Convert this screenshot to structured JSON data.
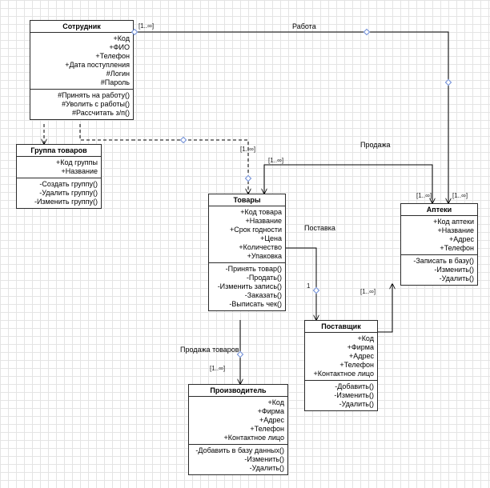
{
  "classes": {
    "employee": {
      "title": "Сотрудник",
      "attrs": [
        "+Код",
        "+ФИО",
        "+Телефон",
        "+Дата поступления",
        "#Логин",
        "#Пароль"
      ],
      "ops": [
        "#Принять на работу()",
        "#Уволить с работы()",
        "#Рассчитать з/п()"
      ]
    },
    "group": {
      "title": "Группа товаров",
      "attrs": [
        "+Код группы",
        "+Название"
      ],
      "ops": [
        "-Создать группу()",
        "-Удалить группу()",
        "-Изменить группу()"
      ]
    },
    "goods": {
      "title": "Товары",
      "attrs": [
        "+Код товара",
        "+Название",
        "+Срок годности",
        "+Цена",
        "+Количество",
        "+Упаковка"
      ],
      "ops": [
        "-Принять товар()",
        "-Продать()",
        "-Изменить запись()",
        "-Заказать()",
        "-Выписать чек()"
      ]
    },
    "pharmacy": {
      "title": "Аптеки",
      "attrs": [
        "+Код аптеки",
        "+Название",
        "+Адрес",
        "+Телефон"
      ],
      "ops": [
        "-Записать в базу()",
        "-Изменить()",
        "-Удалить()"
      ]
    },
    "supplier": {
      "title": "Поставщик",
      "attrs": [
        "+Код",
        "+Фирма",
        "+Адрес",
        "+Телефон",
        "+Контактное лицо"
      ],
      "ops": [
        "-Добавить()",
        "-Изменить()",
        "-Удалить()"
      ]
    },
    "manufacturer": {
      "title": "Производитель",
      "attrs": [
        "+Код",
        "+Фирма",
        "+Адрес",
        "+Телефон",
        "+Контактное лицо"
      ],
      "ops": [
        "-Добавить в базу данных()",
        "-Изменить()",
        "-Удалить()"
      ]
    }
  },
  "associations": {
    "work": "Работа",
    "sale": "Продажа",
    "delivery": "Поставка",
    "goods_sale": "Продажа товаров"
  },
  "mult": {
    "one_inf": "[1..∞]",
    "one": "1"
  },
  "chart_data": {
    "type": "uml-class-diagram",
    "classes": [
      {
        "id": "employee",
        "name": "Сотрудник",
        "attributes": [
          "+Код",
          "+ФИО",
          "+Телефон",
          "+Дата поступления",
          "#Логин",
          "#Пароль"
        ],
        "operations": [
          "#Принять на работу()",
          "#Уволить с работы()",
          "#Рассчитать з/п()"
        ]
      },
      {
        "id": "group",
        "name": "Группа товаров",
        "attributes": [
          "+Код группы",
          "+Название"
        ],
        "operations": [
          "-Создать группу()",
          "-Удалить группу()",
          "-Изменить группу()"
        ]
      },
      {
        "id": "goods",
        "name": "Товары",
        "attributes": [
          "+Код товара",
          "+Название",
          "+Срок годности",
          "+Цена",
          "+Количество",
          "+Упаковка"
        ],
        "operations": [
          "-Принять товар()",
          "-Продать()",
          "-Изменить запись()",
          "-Заказать()",
          "-Выписать чек()"
        ]
      },
      {
        "id": "pharmacy",
        "name": "Аптеки",
        "attributes": [
          "+Код аптеки",
          "+Название",
          "+Адрес",
          "+Телефон"
        ],
        "operations": [
          "-Записать в базу()",
          "-Изменить()",
          "-Удалить()"
        ]
      },
      {
        "id": "supplier",
        "name": "Поставщик",
        "attributes": [
          "+Код",
          "+Фирма",
          "+Адрес",
          "+Телефон",
          "+Контактное лицо"
        ],
        "operations": [
          "-Добавить()",
          "-Изменить()",
          "-Удалить()"
        ]
      },
      {
        "id": "manufacturer",
        "name": "Производитель",
        "attributes": [
          "+Код",
          "+Фирма",
          "+Адрес",
          "+Телефон",
          "+Контактное лицо"
        ],
        "operations": [
          "-Добавить в базу данных()",
          "-Изменить()",
          "-Удалить()"
        ]
      }
    ],
    "relations": [
      {
        "name": "Работа",
        "from": "employee",
        "to": "pharmacy",
        "from_mult": "[1..∞]",
        "to_mult": "[1..∞]",
        "style": "solid"
      },
      {
        "name": "",
        "from": "employee",
        "to": "group",
        "from_mult": "",
        "to_mult": "",
        "style": "dashed"
      },
      {
        "name": "",
        "from": "employee",
        "to": "goods",
        "from_mult": "",
        "to_mult": "[1..∞]",
        "style": "dashed"
      },
      {
        "name": "Продажа",
        "from": "goods",
        "to": "pharmacy",
        "from_mult": "[1..∞]",
        "to_mult": "[1..∞]",
        "style": "solid"
      },
      {
        "name": "Поставка",
        "from": "goods",
        "to": "supplier",
        "from_mult": "1",
        "to_mult": "[1..∞]",
        "style": "solid"
      },
      {
        "name": "Продажа товаров",
        "from": "goods",
        "to": "manufacturer",
        "from_mult": "",
        "to_mult": "[1..∞]",
        "style": "solid"
      },
      {
        "name": "",
        "from": "supplier",
        "to": "pharmacy",
        "from_mult": "",
        "to_mult": "",
        "style": "solid"
      }
    ]
  }
}
